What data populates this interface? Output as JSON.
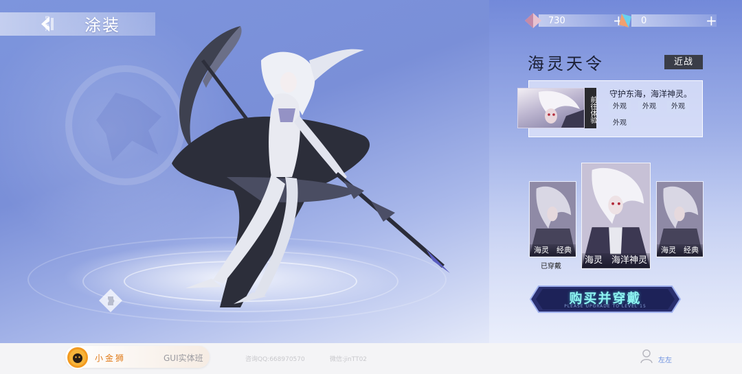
{
  "header": {
    "title": "涂装",
    "back_label": "BACK"
  },
  "currency": [
    {
      "icon": "crystal-icon",
      "value": "730",
      "plus": "+"
    },
    {
      "icon": "diamond-icon",
      "value": "0",
      "plus": "+"
    }
  ],
  "hero": {
    "name": "海灵天令",
    "class": "近战"
  },
  "featured_skin": {
    "try_label": "前往体验",
    "description": "守护东海，海洋神灵。",
    "tags": [
      "外观",
      "外观",
      "外观",
      "外观"
    ]
  },
  "skins": [
    {
      "caption": "海灵　经典",
      "status": "已穿戴",
      "selected": false
    },
    {
      "caption": "海灵　海洋神灵",
      "status": "",
      "selected": true
    },
    {
      "caption": "海灵　经典",
      "status": "",
      "selected": false
    }
  ],
  "buy_button": {
    "label": "购买并穿戴",
    "sub_label": "PLEASE UPGRADE TO LEVEL 15"
  },
  "footer": {
    "brand": "小金狮",
    "course": "GUI实体班",
    "contact_qq": "咨询QQ:668970570",
    "contact_wechat": "微信:jinTT02",
    "user": "左左"
  },
  "colors": {
    "accent": "#8ef3f0",
    "badge_bg": "#3a3d48",
    "brand_orange": "#e07a18"
  }
}
